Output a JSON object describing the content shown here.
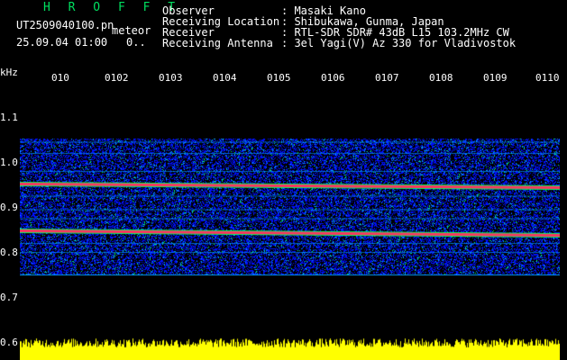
{
  "header": {
    "logo": "H R O F F T",
    "file_name": "UT2509040100.pn",
    "file_tag": "meteor",
    "datetime": "25.09.04 01:00",
    "datetime_tail": "0..",
    "observer_label": "Observer",
    "observer_value": ": Masaki Kano",
    "location_label": "Receiving Location",
    "location_value": ": Shibukawa, Gunma, Japan",
    "receiver_label": "Receiver",
    "receiver_value": ": RTL-SDR SDR# 43dB L15 103.2MHz CW",
    "antenna_label": "Receiving Antenna",
    "antenna_value": ": 3el Yagi(V) Az 330 for Vladivostok"
  },
  "axis": {
    "unit": "kHz",
    "y_ticks": [
      "1.1",
      "1.0",
      "0.9",
      "0.8",
      "0.7",
      "0.6"
    ],
    "x_ticks": [
      "010",
      "0102",
      "0103",
      "0104",
      "0105",
      "0106",
      "0107",
      "0108",
      "0109",
      "0110"
    ]
  },
  "chart_data": {
    "type": "heatmap",
    "title": "",
    "ylabel": "kHz",
    "ylim": [
      0.6,
      1.15
    ],
    "y_ticks": [
      1.1,
      1.0,
      0.9,
      0.8,
      0.7,
      0.6
    ],
    "x_ticks": [
      "010",
      "0102",
      "0103",
      "0104",
      "0105",
      "0106",
      "0107",
      "0108",
      "0109",
      "0110"
    ],
    "bright_lines_khz": [
      0.952,
      0.848
    ],
    "band_khz": [
      0.75,
      1.05
    ],
    "colors": {
      "background": "#000000",
      "noise_low": "#0010ff",
      "noise_mid": "#00a0ff",
      "noise_high": "#00ff60",
      "peak": "#ff3060",
      "amplitude": "#ffff00"
    }
  }
}
